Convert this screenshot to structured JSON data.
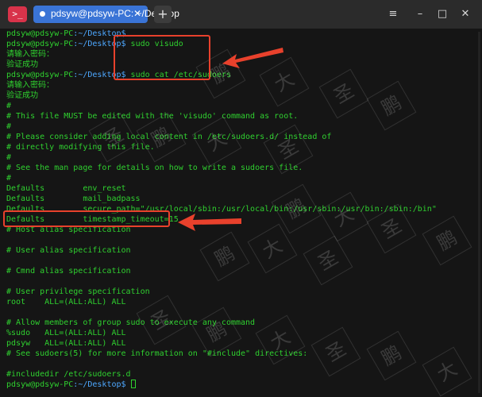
{
  "titlebar": {
    "app_icon": ">_",
    "tab_title": "pdsyw@pdsyw-PC: ~/Desktop",
    "new_tab": "+",
    "btn_menu": "≡",
    "btn_min": "–",
    "btn_max": "□",
    "btn_close": "✕",
    "tab_close": "✕"
  },
  "terminal": {
    "prompt_user": "pdsyw@pdsyw-PC",
    "prompt_path": ":~/Desktop$",
    "lines": [
      {
        "kind": "prompt",
        "cmd": ""
      },
      {
        "kind": "prompt",
        "cmd": " sudo visudo"
      },
      {
        "kind": "text",
        "text": "请输入密码："
      },
      {
        "kind": "text",
        "text": "验证成功"
      },
      {
        "kind": "prompt",
        "cmd": " sudo cat /etc/sudoers"
      },
      {
        "kind": "text",
        "text": "请输入密码："
      },
      {
        "kind": "text",
        "text": "验证成功"
      },
      {
        "kind": "text",
        "text": "#"
      },
      {
        "kind": "text",
        "text": "# This file MUST be edited with the 'visudo' command as root."
      },
      {
        "kind": "text",
        "text": "#"
      },
      {
        "kind": "text",
        "text": "# Please consider adding local content in /etc/sudoers.d/ instead of"
      },
      {
        "kind": "text",
        "text": "# directly modifying this file."
      },
      {
        "kind": "text",
        "text": "#"
      },
      {
        "kind": "text",
        "text": "# See the man page for details on how to write a sudoers file."
      },
      {
        "kind": "text",
        "text": "#"
      },
      {
        "kind": "text",
        "text": "Defaults        env_reset"
      },
      {
        "kind": "text",
        "text": "Defaults        mail_badpass"
      },
      {
        "kind": "text",
        "text": "Defaults        secure_path=\"/usr/local/sbin:/usr/local/bin:/usr/sbin:/usr/bin:/sbin:/bin\""
      },
      {
        "kind": "text",
        "text": "Defaults        timestamp_timeout=15"
      },
      {
        "kind": "text",
        "text": "# Host alias specification"
      },
      {
        "kind": "text",
        "text": ""
      },
      {
        "kind": "text",
        "text": "# User alias specification"
      },
      {
        "kind": "text",
        "text": ""
      },
      {
        "kind": "text",
        "text": "# Cmnd alias specification"
      },
      {
        "kind": "text",
        "text": ""
      },
      {
        "kind": "text",
        "text": "# User privilege specification"
      },
      {
        "kind": "text",
        "text": "root    ALL=(ALL:ALL) ALL"
      },
      {
        "kind": "text",
        "text": ""
      },
      {
        "kind": "text",
        "text": "# Allow members of group sudo to execute any command"
      },
      {
        "kind": "text",
        "text": "%sudo   ALL=(ALL:ALL) ALL"
      },
      {
        "kind": "text",
        "text": "pdsyw   ALL=(ALL:ALL) ALL"
      },
      {
        "kind": "text",
        "text": "# See sudoers(5) for more information on \"#include\" directives:"
      },
      {
        "kind": "text",
        "text": ""
      },
      {
        "kind": "text",
        "text": "#includedir /etc/sudoers.d"
      },
      {
        "kind": "prompt",
        "cmd": " ",
        "cursor": true
      }
    ]
  },
  "watermark": {
    "chars": [
      "鹏",
      "大",
      "圣"
    ]
  },
  "colors": {
    "terminal_text": "#2fd02f",
    "path": "#4ea8ff",
    "highlight": "#e8412c",
    "tab": "#3a74d6"
  }
}
